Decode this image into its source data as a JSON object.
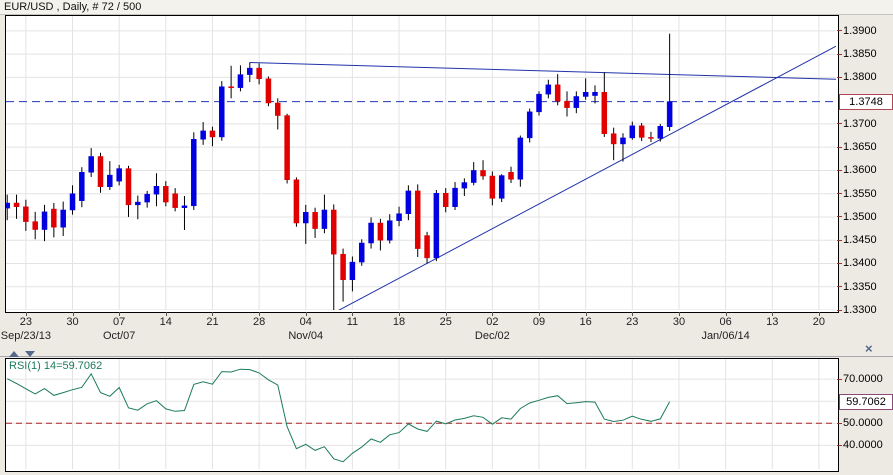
{
  "title": "EUR/USD , Daily, # 72 / 500",
  "colors": {
    "bull": "#0000e0",
    "bear": "#e00000",
    "wick": "#000000",
    "grid": "#e3e3e3",
    "trendline": "#2233aa",
    "price_line": "#2438b8",
    "rsi_line": "#1d7a5c",
    "rsi_level_line": "#aa2222",
    "axis_tick": "#a03030",
    "price_badge_border": "#b04858",
    "rsi_badge_border": "#8b4a7a"
  },
  "divider": {
    "close_glyph": "×"
  },
  "chart_data": [
    {
      "type": "candlestick",
      "title": "EUR/USD , Daily, # 72 / 500",
      "symbol": "EUR/USD",
      "period": "Daily",
      "bars_shown": "# 72 / 500",
      "ylim": [
        1.33,
        1.3932
      ],
      "grid": true,
      "price_axis": {
        "labels": [
          "1.3900",
          "1.3850",
          "1.3800",
          "1.3700",
          "1.3650",
          "1.3600",
          "1.3550",
          "1.3500",
          "1.3450",
          "1.3400",
          "1.3350",
          "1.3300"
        ],
        "current_price": 1.3748,
        "current_price_label": "1.3748"
      },
      "time_axis": {
        "first_tick_bar": 2,
        "bar_step": 5,
        "tick_count": 18,
        "week_ticks": [
          "23",
          "30",
          "07",
          "14",
          "21",
          "28",
          "04",
          "11",
          "18",
          "25",
          "02",
          "09",
          "16",
          "23",
          "30",
          "06",
          "13",
          "20"
        ],
        "month_labels": [
          {
            "text": "Sep/23/13",
            "tick_index": 0
          },
          {
            "text": "Oct/07",
            "tick_index": 2
          },
          {
            "text": "Nov/04",
            "tick_index": 6
          },
          {
            "text": "Dec/02",
            "tick_index": 10
          },
          {
            "text": "Jan/06/14",
            "tick_index": 15
          }
        ]
      },
      "candles_ohlc": [
        [
          1.3519,
          1.3548,
          1.3493,
          1.353
        ],
        [
          1.353,
          1.3548,
          1.3496,
          1.3522
        ],
        [
          1.3522,
          1.3537,
          1.347,
          1.349
        ],
        [
          1.349,
          1.3511,
          1.3452,
          1.3473
        ],
        [
          1.3473,
          1.3526,
          1.3448,
          1.3511
        ],
        [
          1.3517,
          1.353,
          1.3456,
          1.3478
        ],
        [
          1.3478,
          1.3533,
          1.3459,
          1.3515
        ],
        [
          1.3515,
          1.3568,
          1.3505,
          1.355
        ],
        [
          1.3535,
          1.3607,
          1.3521,
          1.3596
        ],
        [
          1.3596,
          1.3648,
          1.3586,
          1.363
        ],
        [
          1.363,
          1.3638,
          1.3552,
          1.3565
        ],
        [
          1.3565,
          1.362,
          1.3558,
          1.359
        ],
        [
          1.3577,
          1.3612,
          1.3568,
          1.3604
        ],
        [
          1.3604,
          1.361,
          1.35,
          1.3526
        ],
        [
          1.3526,
          1.3546,
          1.3495,
          1.3532
        ],
        [
          1.3532,
          1.3556,
          1.352,
          1.3549
        ],
        [
          1.3549,
          1.3594,
          1.3523,
          1.3566
        ],
        [
          1.3566,
          1.3577,
          1.3523,
          1.3532
        ],
        [
          1.355,
          1.3562,
          1.3512,
          1.352
        ],
        [
          1.352,
          1.3545,
          1.3472,
          1.3524
        ],
        [
          1.3524,
          1.3682,
          1.3515,
          1.3667
        ],
        [
          1.3667,
          1.3704,
          1.3655,
          1.3685
        ],
        [
          1.3685,
          1.3694,
          1.3652,
          1.3672
        ],
        [
          1.3672,
          1.3792,
          1.3664,
          1.378
        ],
        [
          1.378,
          1.3825,
          1.3755,
          1.3778
        ],
        [
          1.3778,
          1.3826,
          1.377,
          1.3806
        ],
        [
          1.3806,
          1.3832,
          1.379,
          1.382
        ],
        [
          1.382,
          1.383,
          1.3785,
          1.3797
        ],
        [
          1.3797,
          1.3802,
          1.3738,
          1.3745
        ],
        [
          1.3745,
          1.3755,
          1.3688,
          1.3718
        ],
        [
          1.3718,
          1.3722,
          1.3572,
          1.358
        ],
        [
          1.358,
          1.3585,
          1.3479,
          1.3487
        ],
        [
          1.3487,
          1.3526,
          1.3442,
          1.351
        ],
        [
          1.351,
          1.352,
          1.3455,
          1.3475
        ],
        [
          1.3475,
          1.3548,
          1.3465,
          1.3515
        ],
        [
          1.3515,
          1.3527,
          1.3295,
          1.342
        ],
        [
          1.342,
          1.3432,
          1.3318,
          1.3365
        ],
        [
          1.3365,
          1.3415,
          1.334,
          1.3403
        ],
        [
          1.3403,
          1.3452,
          1.3395,
          1.3444
        ],
        [
          1.3444,
          1.3499,
          1.3432,
          1.3487
        ],
        [
          1.3487,
          1.3496,
          1.3428,
          1.345
        ],
        [
          1.345,
          1.3506,
          1.3443,
          1.3492
        ],
        [
          1.3492,
          1.3522,
          1.348,
          1.3507
        ],
        [
          1.3507,
          1.3568,
          1.3493,
          1.3556
        ],
        [
          1.3556,
          1.357,
          1.3414,
          1.3432
        ],
        [
          1.346,
          1.3468,
          1.34,
          1.3412
        ],
        [
          1.3412,
          1.3558,
          1.3405,
          1.3551
        ],
        [
          1.3551,
          1.3562,
          1.351,
          1.3522
        ],
        [
          1.3522,
          1.3575,
          1.3515,
          1.3562
        ],
        [
          1.3562,
          1.3583,
          1.3545,
          1.3574
        ],
        [
          1.3574,
          1.3618,
          1.3568,
          1.36
        ],
        [
          1.36,
          1.3622,
          1.358,
          1.3588
        ],
        [
          1.3588,
          1.3598,
          1.3525,
          1.354
        ],
        [
          1.354,
          1.3592,
          1.3532,
          1.3589
        ],
        [
          1.3596,
          1.3608,
          1.3573,
          1.3581
        ],
        [
          1.3581,
          1.3675,
          1.3565,
          1.367
        ],
        [
          1.367,
          1.3733,
          1.366,
          1.3726
        ],
        [
          1.3726,
          1.377,
          1.3718,
          1.3764
        ],
        [
          1.3764,
          1.3795,
          1.3755,
          1.3784
        ],
        [
          1.3784,
          1.3807,
          1.374,
          1.3749
        ],
        [
          1.3749,
          1.377,
          1.3716,
          1.3735
        ],
        [
          1.3735,
          1.377,
          1.3723,
          1.3759
        ],
        [
          1.3759,
          1.3798,
          1.3752,
          1.3768
        ],
        [
          1.3761,
          1.3783,
          1.3744,
          1.3768
        ],
        [
          1.3768,
          1.3811,
          1.3672,
          1.3679
        ],
        [
          1.3679,
          1.3692,
          1.3622,
          1.3657
        ],
        [
          1.3657,
          1.368,
          1.3619,
          1.367
        ],
        [
          1.367,
          1.3705,
          1.3666,
          1.3696
        ],
        [
          1.3696,
          1.3702,
          1.3663,
          1.3671
        ],
        [
          1.3671,
          1.3683,
          1.3661,
          1.3669
        ],
        [
          1.3669,
          1.37,
          1.3662,
          1.3695
        ],
        [
          1.3694,
          1.3894,
          1.3685,
          1.3748
        ]
      ],
      "trendlines": [
        {
          "name": "resistance",
          "from_bar": 26,
          "from_price": 1.3832,
          "to_price_at_right": 1.3796
        },
        {
          "name": "support",
          "from_bar": 35.4,
          "from_price": 1.3298,
          "to_price_at_right": 1.3867
        }
      ],
      "current_price_line": {
        "price": 1.3748,
        "style": "dashed"
      }
    },
    {
      "type": "line",
      "name": "RSI",
      "label": "RSI(1) 14=59.7062",
      "period": 14,
      "current_value": 59.7062,
      "current_value_label": "59.7062",
      "ylim": [
        29.3,
        79.1
      ],
      "grid_levels": [
        70,
        60,
        50,
        40
      ],
      "axis_labels": [
        {
          "text": "70.0000",
          "value": 70
        },
        {
          "text": "50.0000",
          "value": 50
        },
        {
          "text": "40.0000",
          "value": 40
        }
      ],
      "level_line": {
        "value": 50,
        "style": "dashed"
      },
      "values": [
        70.2,
        68.0,
        65.6,
        63.3,
        65.7,
        62.6,
        63.9,
        65.2,
        66.3,
        72.4,
        63.9,
        62.2,
        66.2,
        57.0,
        55.9,
        58.8,
        60.2,
        56.5,
        55.4,
        55.8,
        67.6,
        68.8,
        67.7,
        73.4,
        73.2,
        74.5,
        74.3,
        72.8,
        69.7,
        67.3,
        48.5,
        38.5,
        40.5,
        37.7,
        39.4,
        33.9,
        32.6,
        36.4,
        39.2,
        42.9,
        41.4,
        44.8,
        45.8,
        49.7,
        47.4,
        46.3,
        51.0,
        49.7,
        51.5,
        52.2,
        53.4,
        52.7,
        49.6,
        52.5,
        51.9,
        56.7,
        59.2,
        60.4,
        61.7,
        62.5,
        58.9,
        59.3,
        59.8,
        59.6,
        51.9,
        50.8,
        51.4,
        53.2,
        51.8,
        50.9,
        52.0,
        59.7062
      ]
    }
  ]
}
